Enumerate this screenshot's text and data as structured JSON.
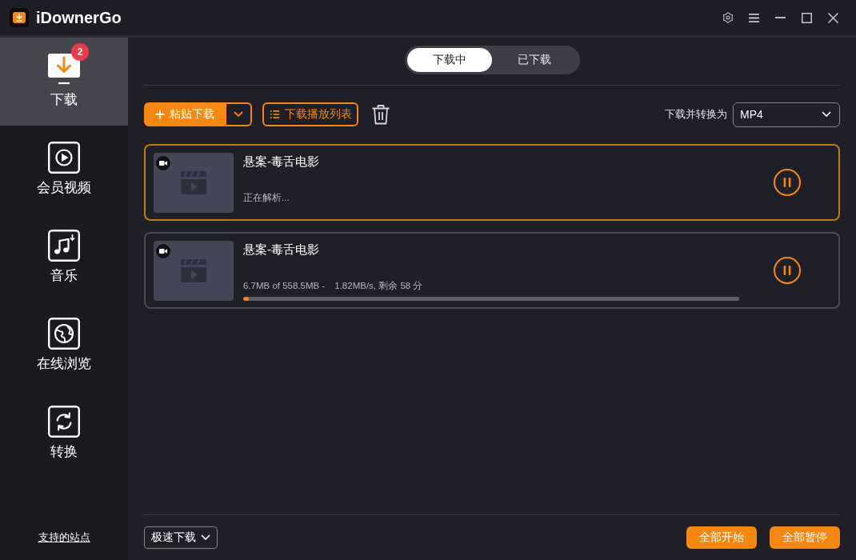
{
  "window": {
    "title": "iDownerGo"
  },
  "sidebar": {
    "items": [
      {
        "label": "下载",
        "selected": true,
        "badge": "2"
      },
      {
        "label": "会员视频",
        "selected": false
      },
      {
        "label": "音乐",
        "selected": false
      },
      {
        "label": "在线浏览",
        "selected": false
      },
      {
        "label": "转换",
        "selected": false
      }
    ],
    "footer_link": "支持的站点"
  },
  "tabs": [
    {
      "label": "下载中",
      "selected": true
    },
    {
      "label": "已下载",
      "selected": false
    }
  ],
  "toolbar": {
    "paste_button": "粘贴下载",
    "playlist_button": "下载播放列表",
    "convert_label": "下载并转换为",
    "format_select": "MP4"
  },
  "downloads": [
    {
      "title": "悬案-毒舌电影",
      "selected": true,
      "status": "正在解析..."
    },
    {
      "title": "悬案-毒舌电影",
      "selected": false,
      "size": "6.7MB of 558.5MB -",
      "speed": "1.82MB/s, 剩余 58 分",
      "level": 0.012
    }
  ],
  "footer": {
    "speed_select": "极速下载",
    "buttons": [
      "全部开始",
      "全部暂停"
    ]
  }
}
